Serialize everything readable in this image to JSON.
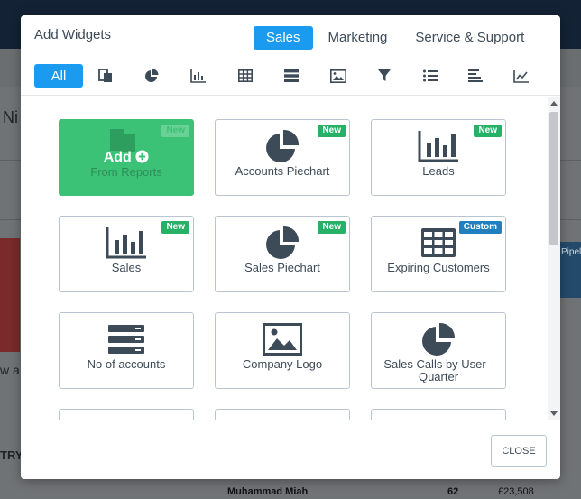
{
  "modal": {
    "title": "Add Widgets",
    "close_label": "CLOSE"
  },
  "tabs": [
    {
      "label": "Sales",
      "active": true
    },
    {
      "label": "Marketing",
      "active": false
    },
    {
      "label": "Service & Support",
      "active": false
    }
  ],
  "filters": {
    "all_label": "All",
    "icons": [
      "reports-icon",
      "piechart-icon",
      "barchart-icon",
      "table-icon",
      "list-rows-icon",
      "image-icon",
      "funnel-icon",
      "bullet-list-icon",
      "horizontal-bar-icon",
      "line-chart-icon"
    ]
  },
  "widgets": [
    {
      "add_text": "Add",
      "label": "From Reports",
      "badge": "New",
      "icon": "add-circle-icon"
    },
    {
      "label": "Accounts Piechart",
      "badge": "New",
      "icon": "piechart-icon"
    },
    {
      "label": "Leads",
      "badge": "New",
      "icon": "barchart-icon"
    },
    {
      "label": "Sales",
      "badge": "New",
      "icon": "barchart-icon"
    },
    {
      "label": "Sales Piechart",
      "badge": "New",
      "icon": "piechart-icon"
    },
    {
      "label": "Expiring Customers",
      "badge": "Custom",
      "icon": "table-icon"
    },
    {
      "label": "No of accounts",
      "icon": "list-rows-icon"
    },
    {
      "label": "Company Logo",
      "icon": "image-icon"
    },
    {
      "label": "Sales Calls by User - Quarter",
      "icon": "piechart-icon"
    }
  ],
  "background": {
    "frag_ni": "Ni",
    "frag_wa": "w a",
    "frag_try": "TRY",
    "frag_pipe": "Pipel",
    "row_name": "Muhammad Miah",
    "row_count": "62",
    "row_amount": "£23,508"
  },
  "colors": {
    "accent": "#1a9bf0",
    "new_badge": "#26b167",
    "custom_badge": "#1f7fc1",
    "add_card": "#3cc277",
    "icon": "#3d4a57"
  }
}
